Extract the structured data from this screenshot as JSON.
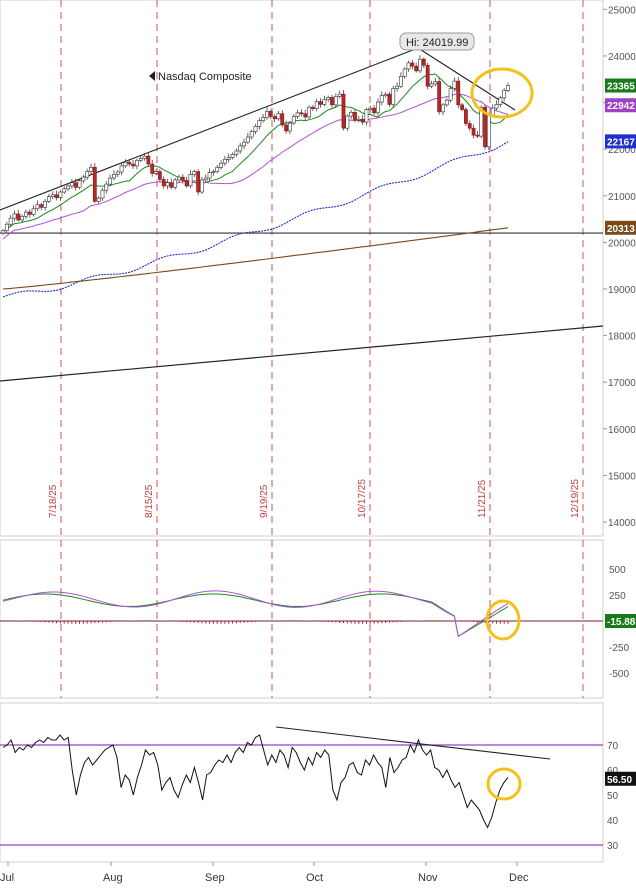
{
  "chart_data": {
    "type": "line",
    "title": "Nasdaq Composite",
    "date_labels": [
      "7/18/25",
      "8/15/25",
      "9/19/25",
      "10/17/25",
      "11/21/25",
      "12/19/25"
    ],
    "month_labels": [
      "Jul",
      "Aug",
      "Sep",
      "Oct",
      "Nov",
      "Dec"
    ],
    "hi_label": "Hi: 24019.99",
    "price_panel": {
      "yticks": [
        "25000",
        "24000",
        "23000",
        "22000",
        "21000",
        "20000",
        "19000",
        "18000",
        "17000",
        "16000",
        "15000",
        "14000"
      ],
      "ylim": [
        13700,
        25200
      ],
      "price_badges": [
        {
          "text": "23365",
          "value": 23365,
          "color": "#1a7a1a"
        },
        {
          "text": "22942",
          "value": 22942,
          "color": "#a040c8"
        },
        {
          "text": "22167",
          "value": 22167,
          "color": "#1f2fd0"
        },
        {
          "text": "20313",
          "value": 20313,
          "color": "#7a4a1a"
        }
      ],
      "horizontal_line": 20200,
      "candles": {
        "start_close": 20250,
        "closes": [
          20250,
          20390,
          20520,
          20610,
          20480,
          20560,
          20650,
          20600,
          20720,
          20810,
          20750,
          20880,
          20980,
          21020,
          20960,
          21080,
          21150,
          21210,
          21280,
          21180,
          21320,
          21400,
          21520,
          21610,
          20880,
          20950,
          21120,
          21250,
          21380,
          21460,
          21510,
          21640,
          21720,
          21680,
          21640,
          21760,
          21800,
          21850,
          21680,
          21480,
          21520,
          21350,
          21210,
          21280,
          21180,
          21340,
          21400,
          21330,
          21210,
          21460,
          21520,
          21080,
          21340,
          21380,
          21500,
          21520,
          21610,
          21700,
          21780,
          21820,
          21890,
          21960,
          22070,
          22150,
          22260,
          22380,
          22490,
          22610,
          22680,
          22810,
          22700,
          22650,
          22760,
          22520,
          22390,
          22560,
          22700,
          22780,
          22760,
          22690,
          22900,
          22870,
          23020,
          22960,
          23060,
          23110,
          22950,
          23130,
          23180,
          22450,
          22710,
          22790,
          22620,
          22640,
          22580,
          22850,
          22880,
          22780,
          23010,
          23150,
          23180,
          22960,
          23300,
          23350,
          23560,
          23720,
          23850,
          23780,
          23680,
          23930,
          23800,
          23350,
          23400,
          23450,
          22800,
          22950,
          23050,
          23300,
          23460,
          22950,
          22850,
          22550,
          22450,
          22300,
          22280,
          22900,
          22050,
          22720,
          22880,
          22960,
          23100,
          23260,
          23365
        ]
      }
    },
    "macd_panel": {
      "yticks": [
        "500",
        "250",
        "-250",
        "-500"
      ],
      "badge": "-15.88"
    },
    "rsi_panel": {
      "yticks": [
        "70",
        "60",
        "50",
        "40",
        "30"
      ],
      "badge": "56.50",
      "values": [
        69,
        70,
        72,
        67,
        69,
        68,
        70,
        69,
        71,
        72,
        71,
        73,
        72,
        72,
        74,
        72,
        73,
        60,
        50,
        58,
        63,
        65,
        62,
        64,
        66,
        68,
        69,
        70,
        65,
        53,
        58,
        56,
        50,
        57,
        62,
        68,
        66,
        67,
        62,
        52,
        55,
        57,
        52,
        49,
        54,
        58,
        55,
        61,
        55,
        48,
        58,
        59,
        62,
        64,
        63,
        66,
        63,
        67,
        69,
        67,
        71,
        70,
        73,
        74,
        68,
        62,
        66,
        63,
        68,
        66,
        61,
        69,
        67,
        63,
        60,
        65,
        62,
        67,
        65,
        68,
        66,
        52,
        48,
        55,
        57,
        62,
        63,
        59,
        58,
        64,
        62,
        66,
        63,
        61,
        53,
        65,
        59,
        61,
        64,
        65,
        70,
        67,
        72,
        68,
        66,
        68,
        61,
        60,
        57,
        60,
        56,
        53,
        55,
        50,
        45,
        48,
        46,
        44,
        40,
        37,
        41,
        47,
        52,
        55,
        57
      ]
    }
  }
}
